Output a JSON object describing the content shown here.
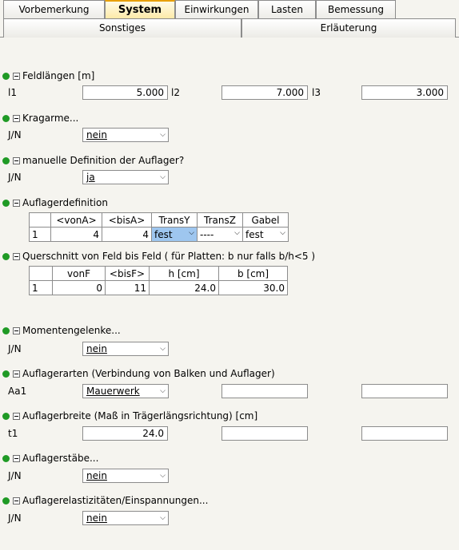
{
  "tabs_row1": [
    "Vorbemerkung",
    "System",
    "Einwirkungen",
    "Lasten",
    "Bemessung"
  ],
  "active_tab": "System",
  "tabs_row2": [
    "Sonstiges",
    "Erläuterung"
  ],
  "feldlaengen": {
    "title": "Feldlängen [m]",
    "l1_label": "l1",
    "l1_value": "5.000",
    "l2_label": "l2",
    "l2_value": "7.000",
    "l3_label": "l3",
    "l3_value": "3.000"
  },
  "kragarme": {
    "title": "Kragarme...",
    "label": "J/N",
    "value": "nein"
  },
  "manuelle": {
    "title": "manuelle Definition der Auflager?",
    "label": "J/N",
    "value": "ja"
  },
  "auflagerdefinition": {
    "title": "Auflagerdefinition",
    "headers": [
      "<vonA>",
      "<bisA>",
      "TransY",
      "TransZ",
      "Gabel"
    ],
    "row": {
      "index": "1",
      "vonA": "4",
      "bisA": "4",
      "transY": "fest",
      "transZ": "----",
      "gabel": "fest"
    }
  },
  "querschnitt": {
    "title": "Querschnitt von Feld bis Feld  ( für Platten: b nur falls b/h<5 )",
    "headers": [
      "vonF",
      "<bisF>",
      "h [cm]",
      "b [cm]"
    ],
    "row": {
      "index": "1",
      "vonF": "0",
      "bisF": "11",
      "h": "24.0",
      "b": "30.0"
    }
  },
  "momentengelenke": {
    "title": "Momentengelenke...",
    "label": "J/N",
    "value": "nein"
  },
  "auflagerarten": {
    "title": "Auflagerarten (Verbindung von Balken und Auflager)",
    "label": "Aa1",
    "value": "Mauerwerk"
  },
  "auflagerbreite": {
    "title": "Auflagerbreite (Maß in Trägerlängsrichtung) [cm]",
    "label": "t1",
    "value": "24.0"
  },
  "auflagerstaebe": {
    "title": "Auflagerstäbe...",
    "label": "J/N",
    "value": "nein"
  },
  "auflagerelast": {
    "title": "Auflagerelastizitäten/Einspannungen...",
    "label": "J/N",
    "value": "nein"
  },
  "colors": {
    "group_dot": "#1f9a25",
    "active_tab_accent": "#e8a000",
    "selection": "#9ec6ef"
  },
  "icons": {
    "group_marker": "green-dot-icon",
    "collapse": "minus-box-icon",
    "dropdown": "chevron-down-icon"
  }
}
